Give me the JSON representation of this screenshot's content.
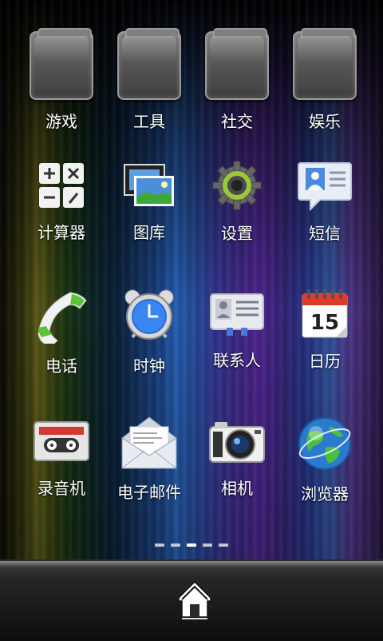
{
  "folders": [
    {
      "label": "游戏",
      "icon": "folder-icon"
    },
    {
      "label": "工具",
      "icon": "folder-icon"
    },
    {
      "label": "社交",
      "icon": "folder-icon"
    },
    {
      "label": "娱乐",
      "icon": "folder-icon"
    }
  ],
  "apps_row1": [
    {
      "label": "计算器",
      "icon": "calculator-icon"
    },
    {
      "label": "图库",
      "icon": "gallery-icon"
    },
    {
      "label": "设置",
      "icon": "settings-gear-icon"
    },
    {
      "label": "短信",
      "icon": "messaging-icon"
    }
  ],
  "apps_row2": [
    {
      "label": "电话",
      "icon": "phone-icon"
    },
    {
      "label": "时钟",
      "icon": "alarm-clock-icon"
    },
    {
      "label": "联系人",
      "icon": "contacts-icon"
    },
    {
      "label": "日历",
      "icon": "calendar-icon"
    }
  ],
  "apps_row3": [
    {
      "label": "录音机",
      "icon": "cassette-recorder-icon"
    },
    {
      "label": "电子邮件",
      "icon": "email-envelope-icon"
    },
    {
      "label": "相机",
      "icon": "camera-icon"
    },
    {
      "label": "浏览器",
      "icon": "globe-browser-icon"
    }
  ],
  "calendar_day": "15",
  "pager": {
    "pages": 5,
    "current": 3
  },
  "dock": {
    "home_icon": "home-icon"
  }
}
